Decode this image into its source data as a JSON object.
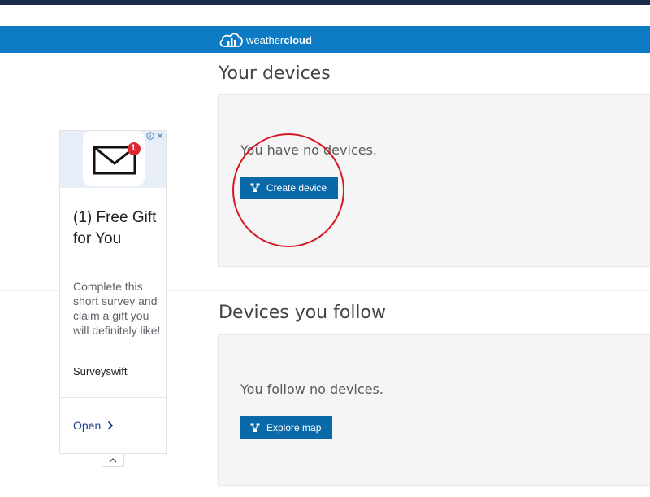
{
  "app": {
    "brand_light": "weather",
    "brand_bold": "cloud"
  },
  "my_devices": {
    "title": "Your devices",
    "empty_message": "You have no devices.",
    "button_label": "Create device"
  },
  "followed_devices": {
    "title": "Devices you follow",
    "empty_message": "You follow no devices.",
    "button_label": "Explore map"
  },
  "ad": {
    "notification_count": "1",
    "title": "(1) Free Gift for You",
    "body": "Complete this short survey and claim a gift you will definitely like!",
    "advertiser": "Surveyswift",
    "cta_label": "Open"
  },
  "colors": {
    "header": "#0c7bc4",
    "button": "#0a69a8",
    "annotation": "#d11a24"
  },
  "icons": [
    "weathercloud-logo-icon",
    "device-icon",
    "mail-icon",
    "adchoices-icon",
    "close-icon",
    "chevron-right-icon",
    "chevron-up-icon"
  ]
}
